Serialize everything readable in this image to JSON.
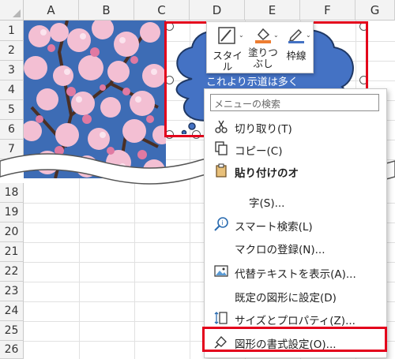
{
  "columns": [
    "A",
    "B",
    "C",
    "D",
    "E",
    "F",
    "G"
  ],
  "rows_top": [
    "1",
    "2",
    "3",
    "4",
    "5",
    "6",
    "7"
  ],
  "rows_bottom": [
    "18",
    "19",
    "20",
    "21",
    "22",
    "23",
    "24",
    "25",
    "26"
  ],
  "shape_text": "これより示道は多く",
  "mini_toolbar": {
    "style_label": "スタイル",
    "fill_label_line1": "塗りつ",
    "fill_label_line2": "ぶし",
    "outline_label": "枠線"
  },
  "context_menu": {
    "search_placeholder": "メニューの検索",
    "cut": "切り取り(T)",
    "copy": "コピー(C)",
    "paste_options": "貼り付けのオ",
    "text_item": "字(S)...",
    "smart_lookup": "スマート検索(L)",
    "assign_macro": "マクロの登録(N)...",
    "alt_text": "代替テキストを表示(A)...",
    "set_default": "既定の図形に設定(D)",
    "size_props": "サイズとプロパティ(Z)...",
    "format_shape": "図形の書式設定(O)..."
  },
  "colors": {
    "highlight": "#e3001b",
    "shape_fill": "#4472c4",
    "fill_accent": "#ed7d31",
    "outline_accent": "#4472c4"
  }
}
